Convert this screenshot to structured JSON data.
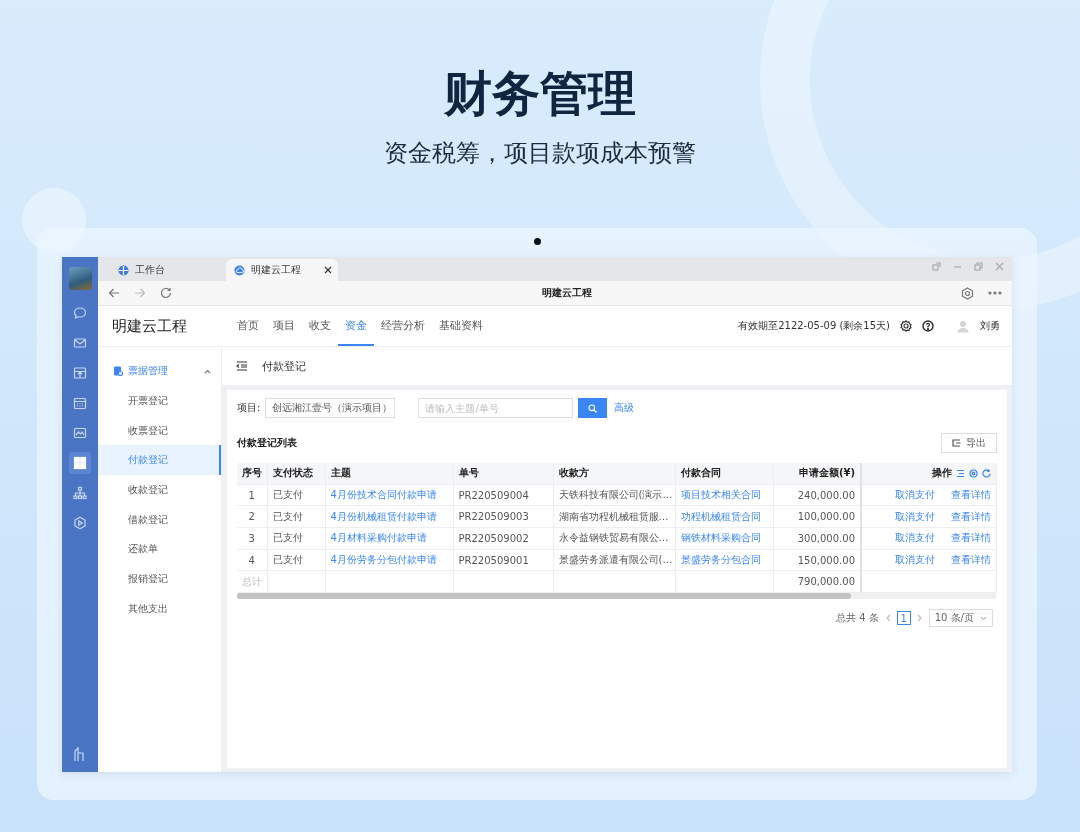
{
  "header": {
    "title": "财务管理",
    "subtitle": "资金税筹，项目款项成本预警"
  },
  "browser": {
    "tabs": [
      {
        "label": "工作台",
        "selected": false
      },
      {
        "label": "明建云工程",
        "selected": true
      }
    ],
    "address_title": "明建云工程"
  },
  "rail": [
    {
      "kind": "chat",
      "selected": false
    },
    {
      "kind": "mail",
      "selected": false
    },
    {
      "kind": "box",
      "selected": false
    },
    {
      "kind": "calendar",
      "selected": false
    },
    {
      "kind": "chart",
      "selected": false
    },
    {
      "kind": "grid",
      "selected": true
    },
    {
      "kind": "org",
      "selected": false
    },
    {
      "kind": "play",
      "selected": false
    }
  ],
  "app": {
    "logo": "明建云工程",
    "nav": [
      {
        "label": "首页",
        "selected": false
      },
      {
        "label": "项目",
        "selected": false
      },
      {
        "label": "收支",
        "selected": false
      },
      {
        "label": "资金",
        "selected": true
      },
      {
        "label": "经营分析",
        "selected": false
      },
      {
        "label": "基础资料",
        "selected": false
      }
    ],
    "validity": "有效期至2122-05-09 (剩余15天)",
    "user": "刘勇"
  },
  "menu": {
    "group": "票据管理",
    "expanded": true,
    "items": [
      {
        "label": "开票登记",
        "selected": false
      },
      {
        "label": "收票登记",
        "selected": false
      },
      {
        "label": "付款登记",
        "selected": true
      },
      {
        "label": "收款登记",
        "selected": false
      },
      {
        "label": "借款登记",
        "selected": false
      },
      {
        "label": "还款单",
        "selected": false
      },
      {
        "label": "报销登记",
        "selected": false
      },
      {
        "label": "其他支出",
        "selected": false
      }
    ]
  },
  "page_title": "付款登记",
  "filter": {
    "label": "项目:",
    "project": "创远湘江壹号（演示项目）",
    "search_placeholder": "请输入主题/单号",
    "advanced": "高级"
  },
  "list_title": "付款登记列表",
  "export": "导出",
  "table": {
    "columns": [
      "序号",
      "支付状态",
      "主题",
      "单号",
      "收款方",
      "付款合同",
      "申请金额(¥)",
      "操作"
    ],
    "rows": [
      {
        "index": "1",
        "status": "已支付",
        "subject": "4月份技术合同付款申请",
        "number": "PR220509004",
        "payee": "天铁科技有限公司(演示…",
        "contract": "项目技术相关合同",
        "amount": "240,000.00",
        "actions": [
          "取消支付",
          "查看详情"
        ]
      },
      {
        "index": "2",
        "status": "已支付",
        "subject": "4月份机械租赁付款申请",
        "number": "PR220509003",
        "payee": "湖南省功程机械租赁服…",
        "contract": "功程机械租赁合同",
        "amount": "100,000.00",
        "actions": [
          "取消支付",
          "查看详情"
        ]
      },
      {
        "index": "3",
        "status": "已支付",
        "subject": "4月材料采购付款申请",
        "number": "PR220509002",
        "payee": "永令益钢铁贸易有限公…",
        "contract": "钢铁材料采购合同",
        "amount": "300,000.00",
        "actions": [
          "取消支付",
          "查看详情"
        ]
      },
      {
        "index": "4",
        "status": "已支付",
        "subject": "4月份劳务分包付款申请",
        "number": "PR220509001",
        "payee": "景盛劳务派遣有限公司(…",
        "contract": "景盛劳务分包合同",
        "amount": "150,000.00",
        "actions": [
          "取消支付",
          "查看详情"
        ]
      }
    ],
    "total": {
      "label": "总计",
      "amount": "790,000.00"
    }
  },
  "pagination": {
    "total": "总共 4 条",
    "pages": [
      {
        "label": "1",
        "selected": true
      }
    ],
    "page_size": "10 条/页"
  }
}
